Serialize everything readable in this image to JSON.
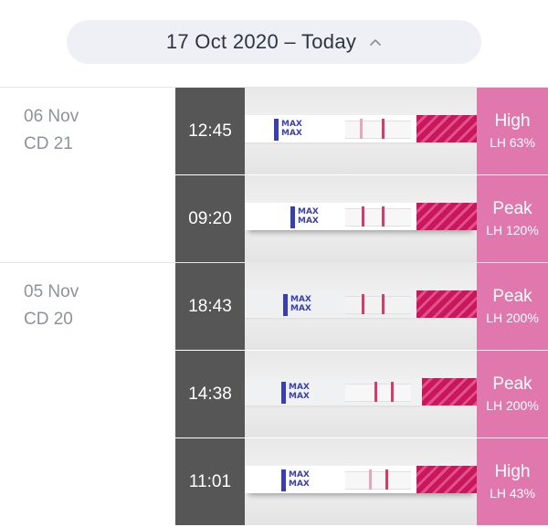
{
  "date_range": {
    "label": "17 Oct 2020 – Today",
    "icon": "chevron-up-icon"
  },
  "colors": {
    "result_bg": "#e178ad",
    "time_bg": "#565656",
    "pill_bg": "#eef0f5"
  },
  "days": [
    {
      "date": "06 Nov",
      "cycle_day": "CD 21",
      "tests": [
        {
          "time": "12:45",
          "level": "High",
          "lh": "LH 63%",
          "strip_label": "MAX"
        },
        {
          "time": "09:20",
          "level": "Peak",
          "lh": "LH 120%",
          "strip_label": "MAX"
        }
      ]
    },
    {
      "date": "05 Nov",
      "cycle_day": "CD 20",
      "tests": [
        {
          "time": "18:43",
          "level": "Peak",
          "lh": "LH 200%",
          "strip_label": "MAX"
        },
        {
          "time": "14:38",
          "level": "Peak",
          "lh": "LH 200%",
          "strip_label": "MAX"
        },
        {
          "time": "11:01",
          "level": "High",
          "lh": "LH 43%",
          "strip_label": "MAX"
        }
      ]
    }
  ]
}
